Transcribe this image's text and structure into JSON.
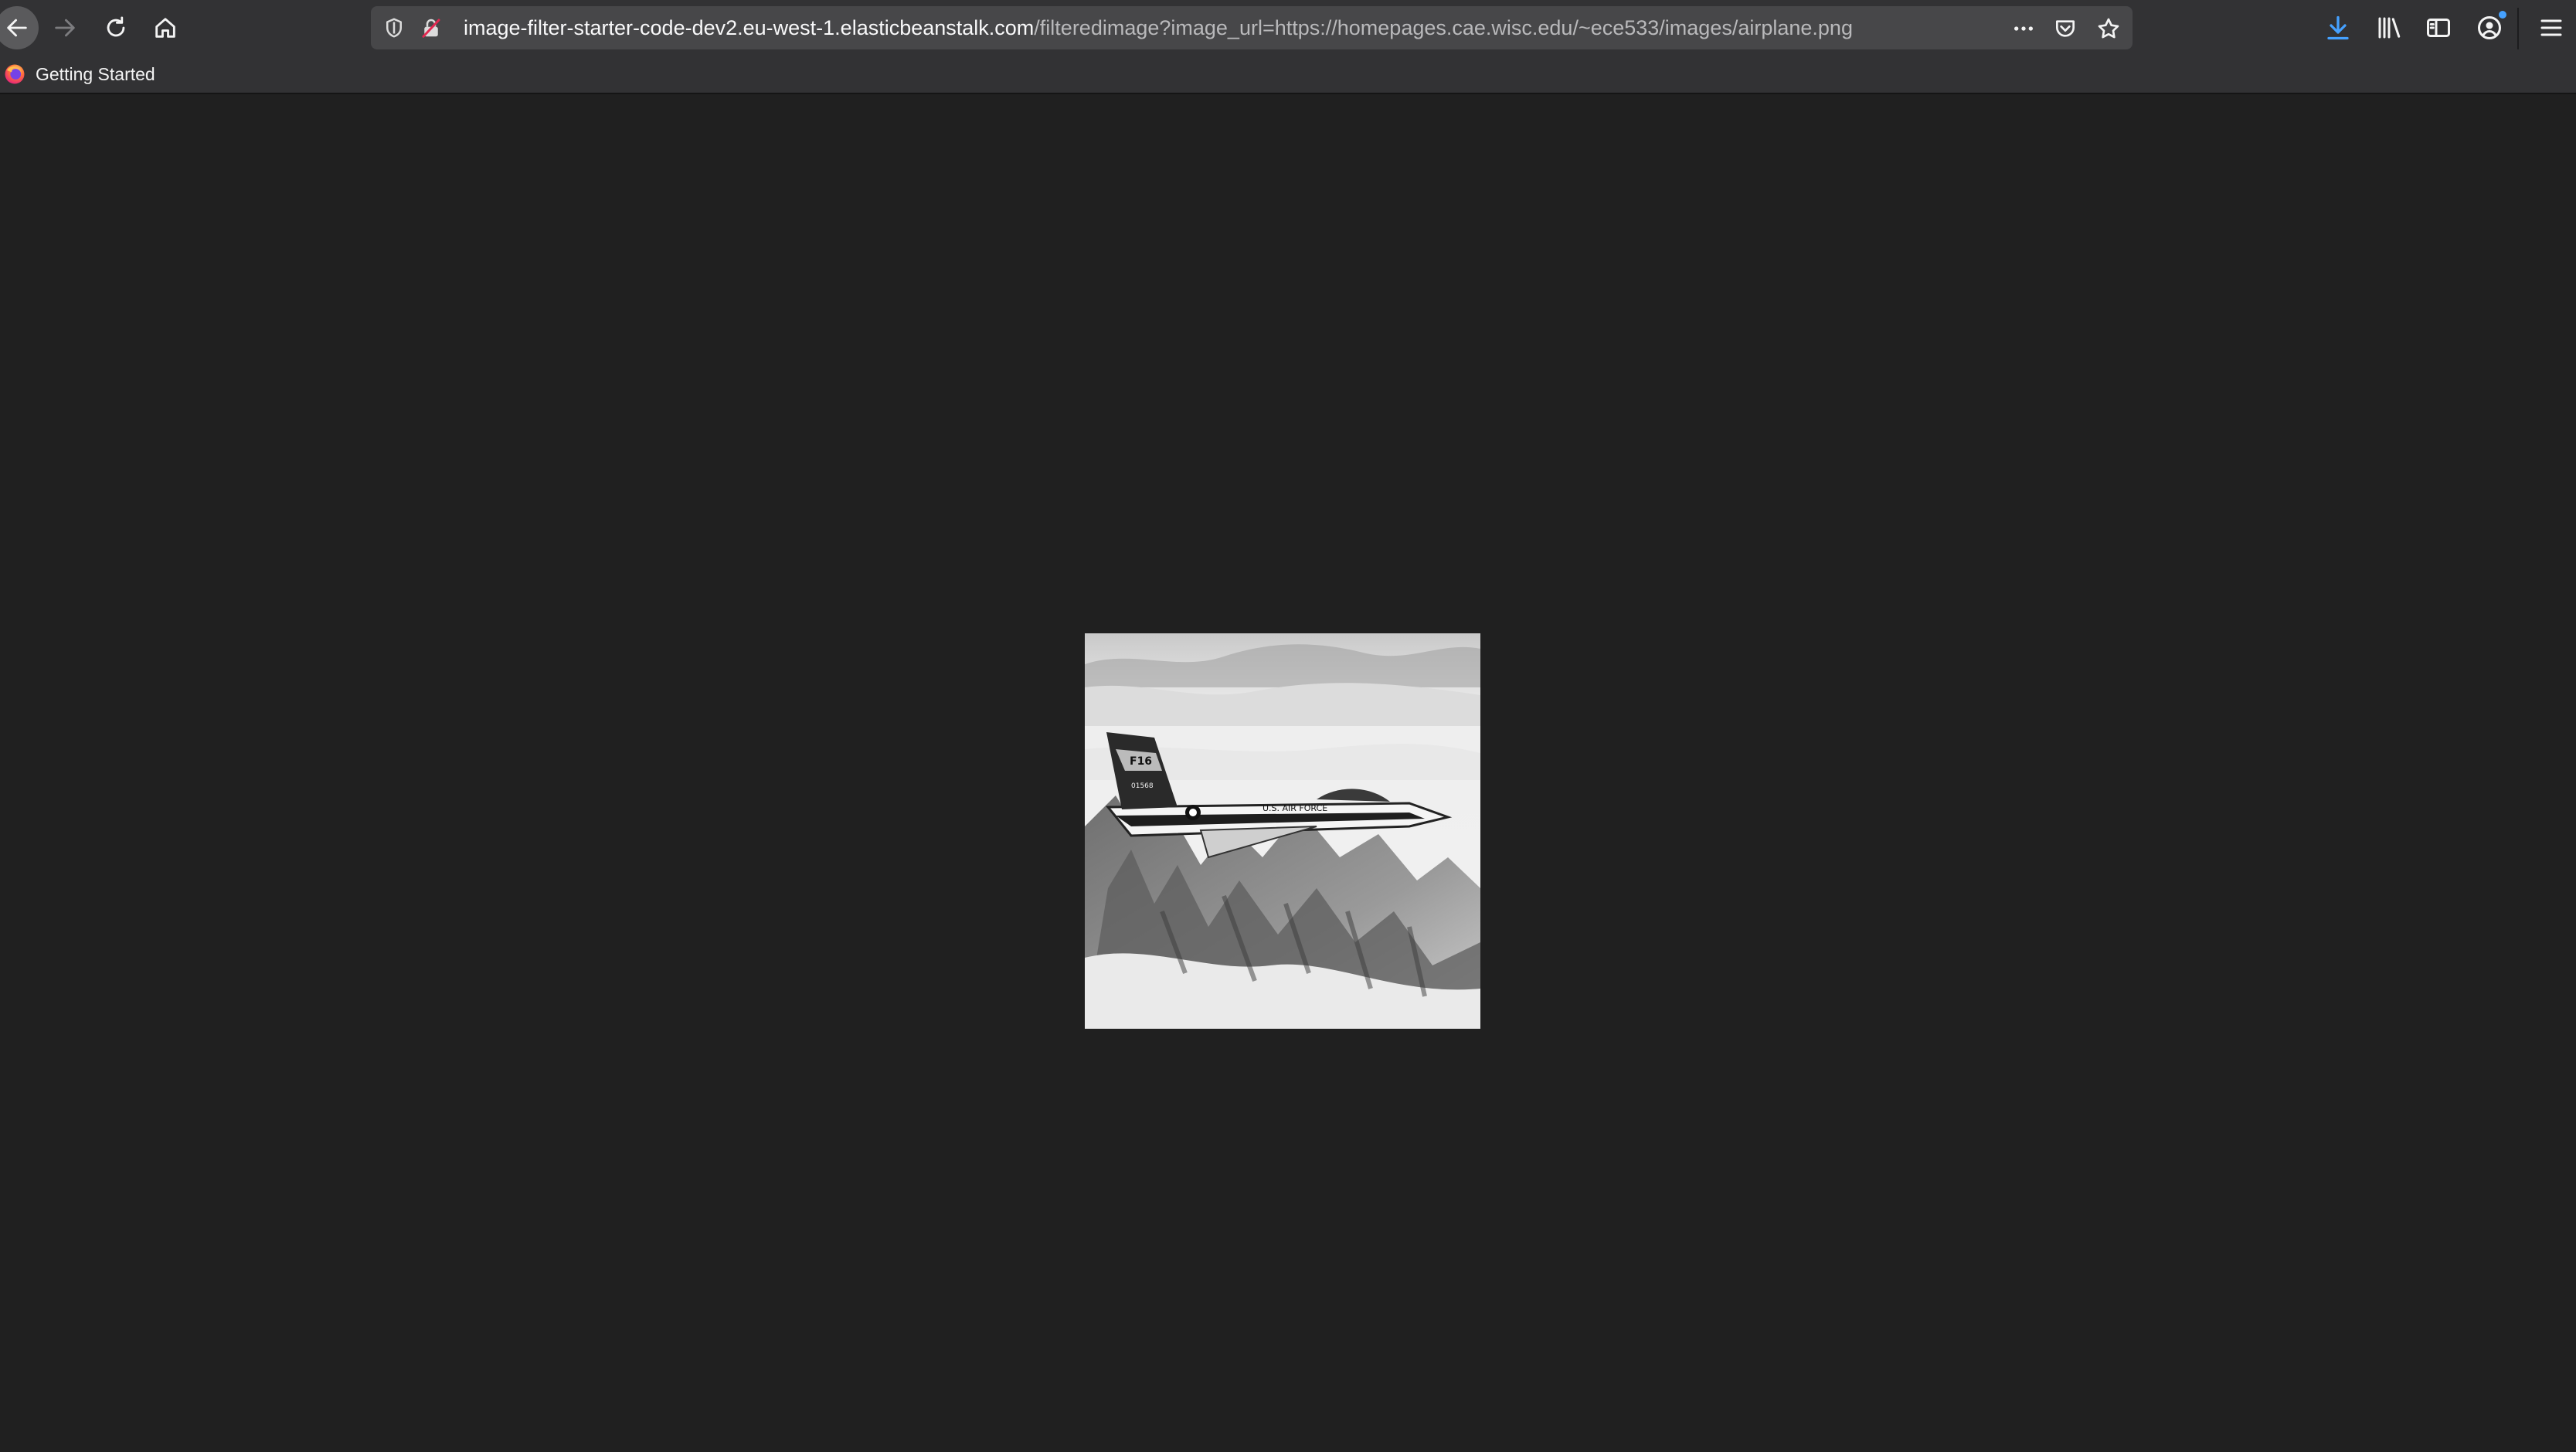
{
  "window": {
    "background": "#202020",
    "toolbar_color": "#323234"
  },
  "toolbar": {
    "back_icon": "back-arrow-icon",
    "forward_icon": "forward-arrow-icon",
    "reload_icon": "reload-icon",
    "home_icon": "home-icon",
    "download_icon": "download-arrow-icon",
    "download_accent": "#45a1ff",
    "library_icon": "library-icon",
    "sidebar_icon": "sidebar-icon",
    "account_icon": "account-icon",
    "menu_icon": "hamburger-menu-icon"
  },
  "urlbar": {
    "security_icon": "shield-icon",
    "insecure_icon": "insecure-lock-icon",
    "host": "image-filter-starter-code-dev2.eu-west-1.elasticbeanstalk.com",
    "path": "/filteredimage?image_url=https://homepages.cae.wisc.edu/~ece533/images/airplane.png",
    "more_icon": "ellipsis-icon",
    "pocket_icon": "pocket-icon",
    "bookmark_icon": "star-icon"
  },
  "bookmarks": {
    "items": [
      {
        "label": "Getting Started",
        "icon": "firefox-icon"
      }
    ]
  },
  "content": {
    "image": {
      "subject": "grayscale airplane photo",
      "plane_text": "U.S. AIR FORCE",
      "tail_text": "F16",
      "serial_text": "01568"
    }
  }
}
